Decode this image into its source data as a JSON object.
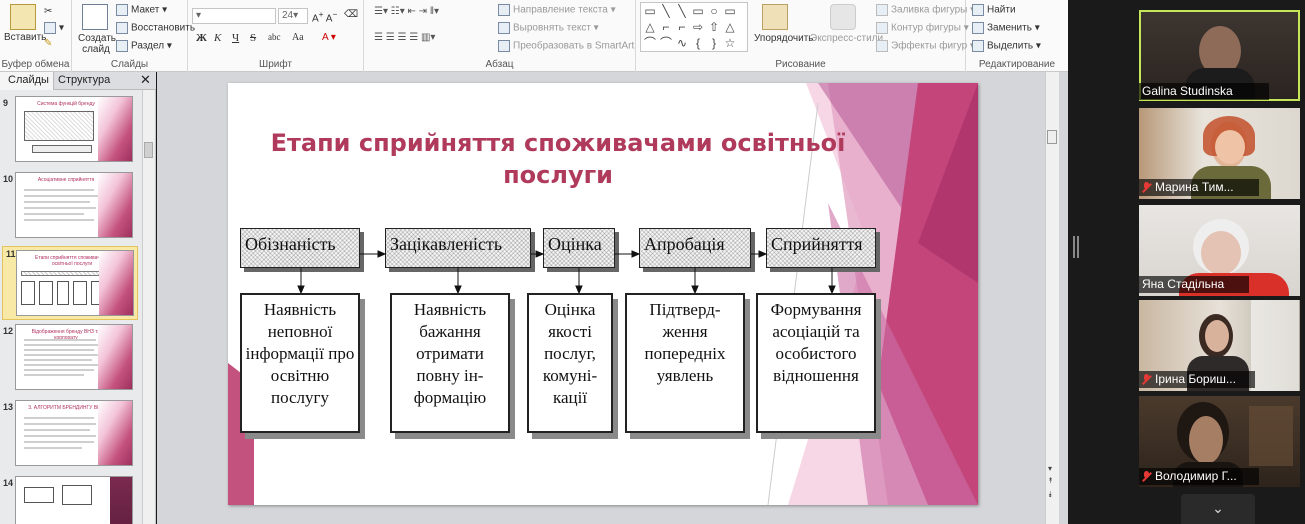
{
  "ribbon": {
    "clipboard": {
      "paste": "Вставить",
      "group": "Буфер обмена"
    },
    "slides": {
      "new_slide": "Создать слайд",
      "layout": "Макет",
      "reset": "Восстановить",
      "section": "Раздел",
      "group": "Слайды"
    },
    "font": {
      "size": "24",
      "group": "Шрифт",
      "bold": "Ж",
      "italic": "К",
      "underline": "Ч",
      "strike": "S",
      "shadow": "abc",
      "case": "Аа"
    },
    "paragraph": {
      "text_direction": "Направление текста",
      "align_text": "Выровнять текст",
      "smartart": "Преобразовать в SmartArt",
      "group": "Абзац"
    },
    "drawing": {
      "arrange": "Упорядочить",
      "quick_styles": "Экспресс-стили",
      "shape_fill": "Заливка фигуры",
      "shape_outline": "Контур фигуры",
      "shape_effects": "Эффекты фигур",
      "group": "Рисование"
    },
    "editing": {
      "find": "Найти",
      "replace": "Заменить",
      "select": "Выделить",
      "group": "Редактирование"
    }
  },
  "left_pane": {
    "tab_slides": "Слайды",
    "tab_outline": "Структура",
    "thumbnails": [
      {
        "num": "9",
        "title": "Система функцій бренду"
      },
      {
        "num": "10",
        "title": "Асоціативне сприйняття"
      },
      {
        "num": "11",
        "title": "Етапи сприйняття споживачами освітньої послуги"
      },
      {
        "num": "12",
        "title": "Відображення бренду ВНЗ та корпорату"
      },
      {
        "num": "13",
        "title": "3. АЛГОРИТМ БРЕНДИНГУ ВНЗ"
      },
      {
        "num": "14",
        "title": ""
      }
    ]
  },
  "slide": {
    "title": "Етапи сприйняття споживачами освітньої послуги",
    "stages": [
      "Обізнаність",
      "Зацікавленість",
      "Оцінка",
      "Апробація",
      "Сприйняття"
    ],
    "descriptions": [
      "Наявність неповної інформації про освітню послугу",
      "Наявність бажання отримати повну ін-формацію",
      "Оцінка якості послуг, комуні-кації",
      "Підтверд-ження попередніх уявлень",
      "Формування асоціацій та особистого відношення"
    ]
  },
  "participants": [
    {
      "name": "Galina Studinska",
      "muted": false
    },
    {
      "name": "Марина Тим...",
      "muted": true
    },
    {
      "name": "Яна Стадільна",
      "muted": false
    },
    {
      "name": "Ірина Бориш...",
      "muted": true
    },
    {
      "name": "Володимир Г...",
      "muted": true
    }
  ],
  "colors": {
    "title": "#b03a5b",
    "accent_pink": "#c4527e",
    "active_speaker": "#c6e65a"
  },
  "icons": [
    "paste-icon",
    "new-slide-icon",
    "chevron-down-icon",
    "arrow-right-icon",
    "mic-muted-icon",
    "scroll-up-icon",
    "scroll-down-icon",
    "close-icon"
  ]
}
